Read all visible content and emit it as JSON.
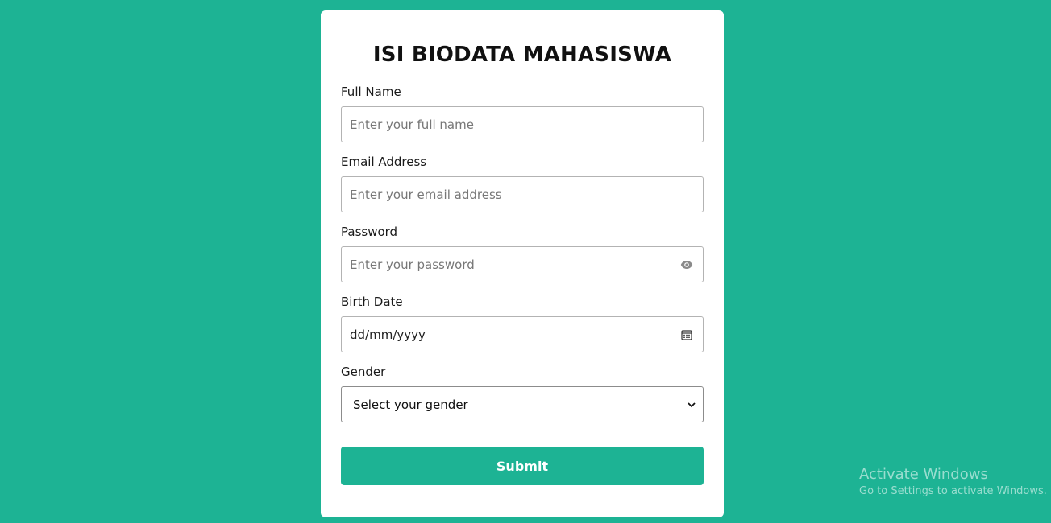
{
  "form": {
    "title": "ISI BIODATA MAHASISWA",
    "full_name": {
      "label": "Full Name",
      "placeholder": "Enter your full name"
    },
    "email": {
      "label": "Email Address",
      "placeholder": "Enter your email address"
    },
    "password": {
      "label": "Password",
      "placeholder": "Enter your password",
      "icon": "eye-icon"
    },
    "birth_date": {
      "label": "Birth Date",
      "value": "dd/mm/yyyy",
      "icon": "calendar-icon"
    },
    "gender": {
      "label": "Gender",
      "selected": "Select your gender",
      "icon": "chevron-down-icon"
    },
    "submit_label": "Submit"
  },
  "watermark": {
    "title": "Activate Windows",
    "subtitle": "Go to Settings to activate Windows."
  },
  "colors": {
    "background": "#1db394",
    "accent": "#1db394",
    "card": "#ffffff"
  }
}
